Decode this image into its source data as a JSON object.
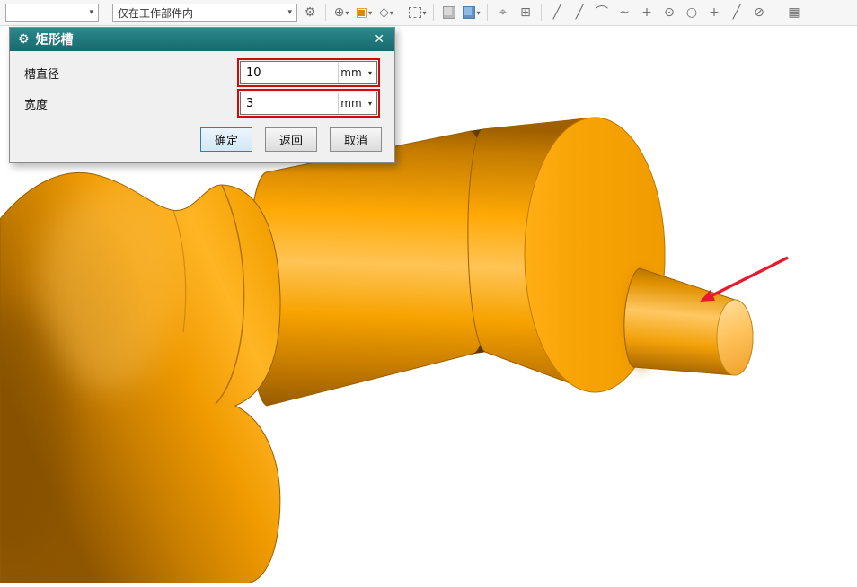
{
  "ui": {
    "caret": "▾",
    "close": "✕",
    "gear": "⚙"
  },
  "toolbar": {
    "scope_combo": {
      "value": ""
    },
    "filter_combo": {
      "value": "仅在工作部件内"
    },
    "icons": [
      {
        "name": "snap-gear-icon",
        "glyph": "⚙"
      },
      {
        "name": "snap-point-icon",
        "glyph": "⊕"
      },
      {
        "name": "work-plane-icon",
        "glyph": "▣"
      },
      {
        "name": "datum-icon",
        "glyph": "◇"
      },
      {
        "name": "selection-rect-icon",
        "glyph": ""
      },
      {
        "name": "cube-gray-icon",
        "glyph": ""
      },
      {
        "name": "cube-blue-icon",
        "glyph": ""
      },
      {
        "name": "orient-icon",
        "glyph": "⌖"
      },
      {
        "name": "handles-icon",
        "glyph": "⊞"
      },
      {
        "name": "line-icon",
        "glyph": "╱"
      },
      {
        "name": "line2-icon",
        "glyph": "╱"
      },
      {
        "name": "arc-icon",
        "glyph": "⌒"
      },
      {
        "name": "spline-icon",
        "glyph": "~"
      },
      {
        "name": "point-icon",
        "glyph": "+"
      },
      {
        "name": "circle-center-icon",
        "glyph": "⊙"
      },
      {
        "name": "circle-icon",
        "glyph": "○"
      },
      {
        "name": "plus-icon",
        "glyph": "+"
      },
      {
        "name": "slash-icon",
        "glyph": "╱"
      },
      {
        "name": "no-snap-icon",
        "glyph": "⊘"
      },
      {
        "name": "grid-icon",
        "glyph": "▦"
      }
    ]
  },
  "dialog": {
    "title": "矩形槽",
    "fields": [
      {
        "label": "槽直径",
        "value": "10",
        "unit": "mm"
      },
      {
        "label": "宽度",
        "value": "3",
        "unit": "mm"
      }
    ],
    "buttons": {
      "ok": "确定",
      "back": "返回",
      "cancel": "取消"
    }
  },
  "viewport": {
    "model": "stepped-shaft-3d"
  },
  "colors": {
    "shaft_orange": "#f5a307",
    "dialog_header": "#2c898c",
    "field_highlight_red": "#d20a0a",
    "annotation_arrow_red": "#e8192c",
    "primary_button_border": "#2d7fb8"
  }
}
